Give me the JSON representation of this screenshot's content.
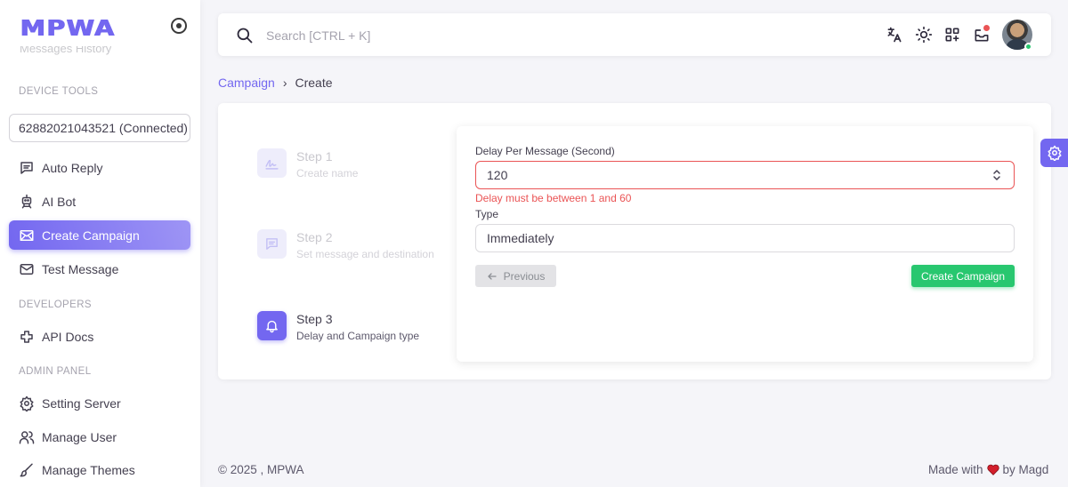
{
  "brand": {
    "logo_text": "MPWA",
    "accent": "#7367f0"
  },
  "sidebar": {
    "cut_item": "Messages History",
    "sections": {
      "device_tools": "DEVICE TOOLS",
      "developers": "DEVELOPERS",
      "admin_panel": "ADMIN PANEL"
    },
    "device_select": "6288202104352​1 (Connected)",
    "items": [
      {
        "label": "Auto Reply",
        "icon": "message-square-icon"
      },
      {
        "label": "AI Bot",
        "icon": "robot-icon"
      },
      {
        "label": "Create Campaign",
        "icon": "mail-open-icon",
        "active": true
      },
      {
        "label": "Test Message",
        "icon": "mail-icon"
      },
      {
        "label": "API Docs",
        "icon": "api-icon"
      },
      {
        "label": "Setting Server",
        "icon": "settings-icon"
      },
      {
        "label": "Manage User",
        "icon": "users-icon"
      },
      {
        "label": "Manage Themes",
        "icon": "brush-icon"
      }
    ]
  },
  "navbar": {
    "search_placeholder": "Search [CTRL + K]",
    "icons": [
      "language-icon",
      "sun-icon",
      "grid-plus-icon",
      "notification-icon",
      "avatar"
    ]
  },
  "breadcrumb": {
    "parent": "Campaign",
    "current": "Create"
  },
  "steps": [
    {
      "title": "Step 1",
      "subtitle": "Create name",
      "icon": "signature-icon"
    },
    {
      "title": "Step 2",
      "subtitle": "Set message and destination",
      "icon": "message-icon"
    },
    {
      "title": "Step 3",
      "subtitle": "Delay and Campaign type",
      "icon": "bell-icon",
      "active": true
    }
  ],
  "form": {
    "delay_label": "Delay Per Message (Second)",
    "delay_value": "120",
    "delay_error": "Delay must be between 1 and 60",
    "type_label": "Type",
    "type_value": "Immediately",
    "previous_label": "Previous",
    "create_label": "Create Campaign"
  },
  "footer": {
    "copyright": "© 2025 , MPWA",
    "made_with": "Made with",
    "by": "by Magd"
  },
  "colors": {
    "primary": "#7367f0",
    "success": "#28c76f",
    "danger": "#ea5455"
  }
}
